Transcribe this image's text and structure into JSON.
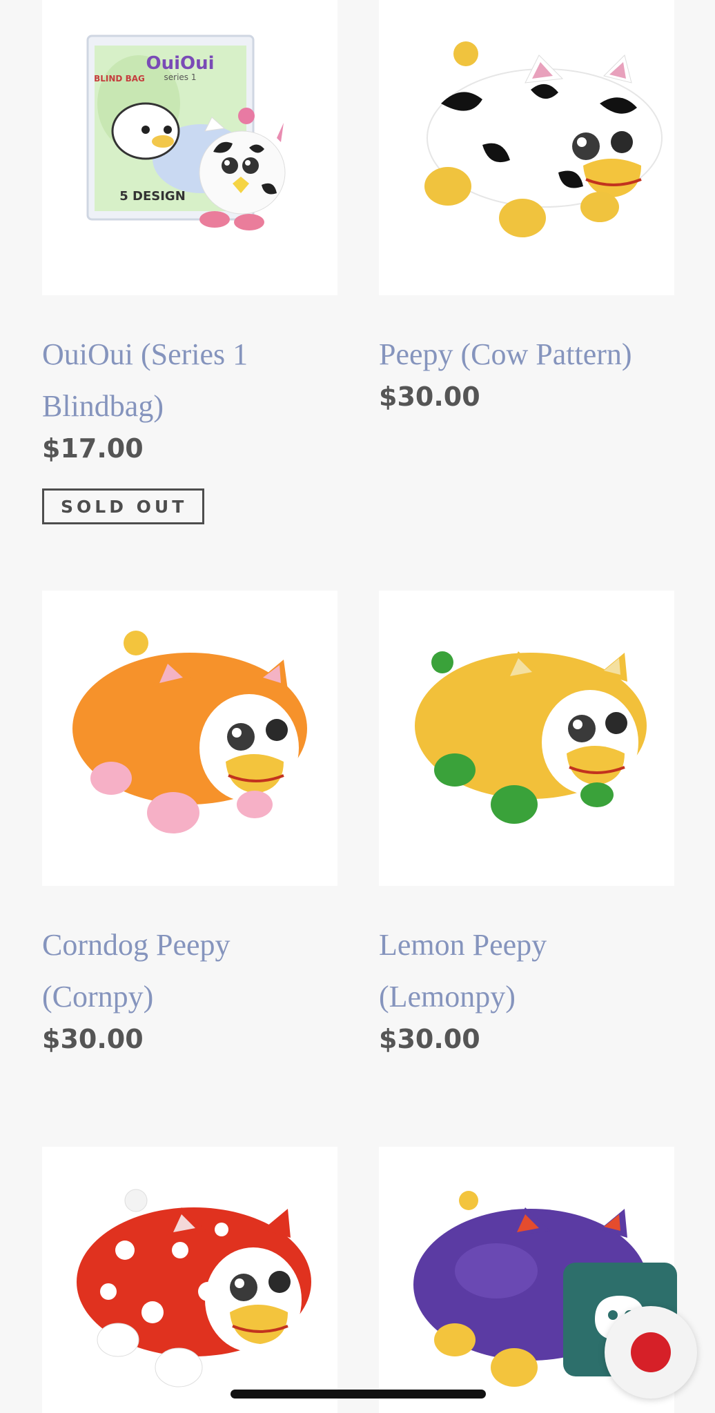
{
  "products": [
    {
      "title_line1": "OuiOui (Series 1",
      "title_line2": "Blindbag)",
      "price": "$17.00",
      "badge": "SOLD OUT",
      "bag_text": "OuiOui",
      "bag_sub": "series 1",
      "bag_badge": "BLIND BAG",
      "bag_footer": "5 DESIGN"
    },
    {
      "title_line1": "Peepy (Cow Pattern)",
      "price": "$30.00"
    },
    {
      "title_line1": "Corndog Peepy",
      "title_line2": "(Cornpy)",
      "price": "$30.00"
    },
    {
      "title_line1": "Lemon Peepy",
      "title_line2": "(Lemonpy)",
      "price": "$30.00"
    },
    {
      "image": "red-polka-dot-plush"
    },
    {
      "image": "purple-plush"
    }
  ],
  "icons": {
    "chat": "chat-bubble-icon",
    "record": "record-icon"
  },
  "colors": {
    "title": "#8594bd",
    "price": "#555555",
    "chat_bg": "#2d6f6b",
    "record": "#d62028"
  }
}
